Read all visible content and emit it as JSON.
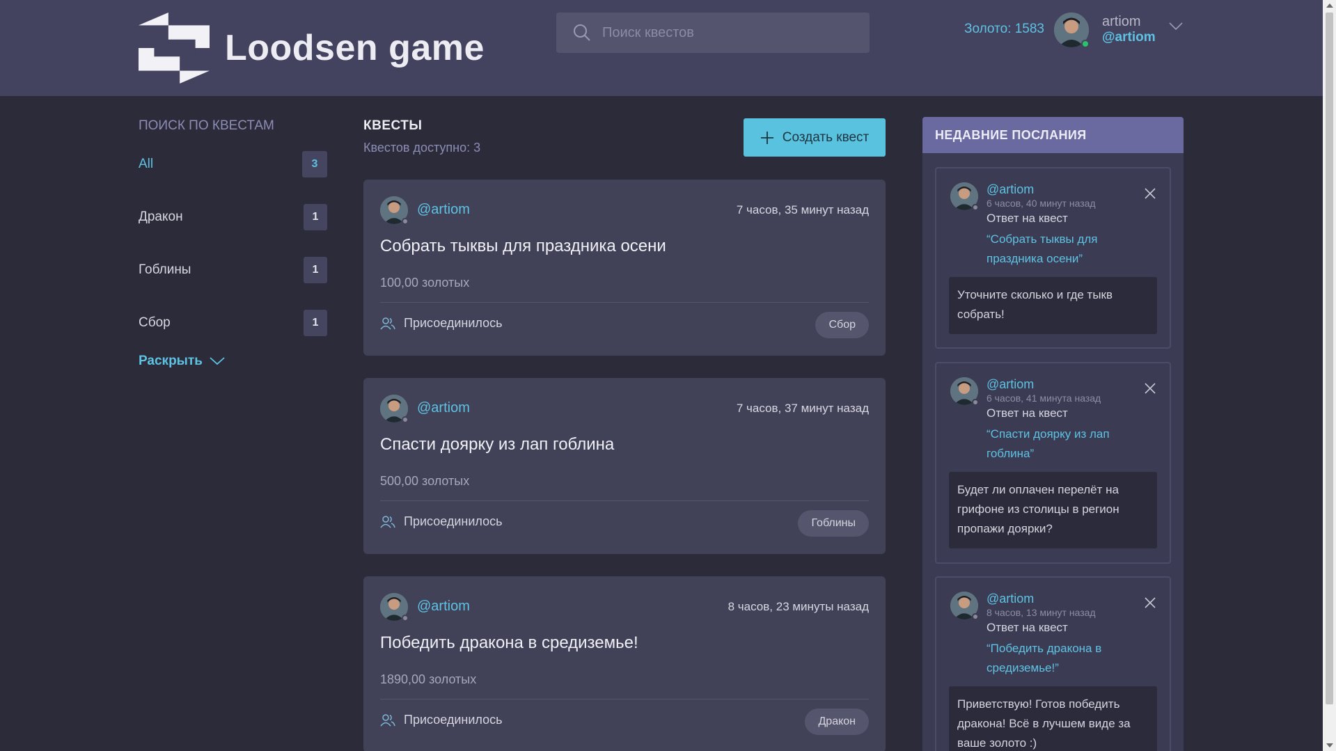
{
  "header": {
    "logo_text": "Loodsen game",
    "search_placeholder": "Поиск квестов",
    "gold_label": "Золото: 1583",
    "user_name": "artiom",
    "user_handle": "@artiom"
  },
  "filters": {
    "title": "ПОИСК ПО КВЕСТАМ",
    "items": [
      {
        "label": "All",
        "count": "3"
      },
      {
        "label": "Дракон",
        "count": "1"
      },
      {
        "label": "Гоблины",
        "count": "1"
      },
      {
        "label": "Сбор",
        "count": "1"
      }
    ],
    "expand_label": "Раскрыть"
  },
  "quests": {
    "title": "КВЕСТЫ",
    "available": "Квестов доступно: 3",
    "create_label": "Создать квест",
    "items": [
      {
        "author": "@artiom",
        "time": "7 часов, 35 минут назад",
        "title": "Собрать тыквы для праздника осени",
        "reward": "100,00 золотых",
        "joined": "Присоединилось",
        "tag": "Сбор"
      },
      {
        "author": "@artiom",
        "time": "7 часов, 37 минут назад",
        "title": "Спасти доярку из лап гоблина",
        "reward": "500,00 золотых",
        "joined": "Присоединилось",
        "tag": "Гоблины"
      },
      {
        "author": "@artiom",
        "time": "8 часов, 23 минуты назад",
        "title": "Победить дракона в средиземье!",
        "reward": "1890,00 золотых",
        "joined": "Присоединилось",
        "tag": "Дракон"
      }
    ]
  },
  "messages": {
    "title": "НЕДАВНИЕ ПОСЛАНИЯ",
    "items": [
      {
        "author": "@artiom",
        "time": "6 часов, 40 минут назад",
        "reply": "Ответ на квест",
        "quest": "“Собрать тыквы для праздника осени”",
        "body": "Уточните сколько и где тыкв собрать!"
      },
      {
        "author": "@artiom",
        "time": "6 часов, 41 минута назад",
        "reply": "Ответ на квест",
        "quest": "“Спасти доярку из лап гоблина”",
        "body": "Будет ли оплачен перелёт на грифоне из столицы в регион пропажи доярки?"
      },
      {
        "author": "@artiom",
        "time": "8 часов, 13 минут назад",
        "reply": "Ответ на квест",
        "quest": "“Победить дракона в средиземье!”",
        "body": "Приветствую! Готов победить дракона! Всё в лучшем виде за ваше золото :)"
      }
    ]
  },
  "colors": {
    "accent": "#5ec3e3",
    "header_bg": "#434360",
    "page_bg": "#2b2b3a",
    "card_bg": "#414158",
    "messages_head": "#6a6aa0",
    "online": "#29c46a"
  }
}
